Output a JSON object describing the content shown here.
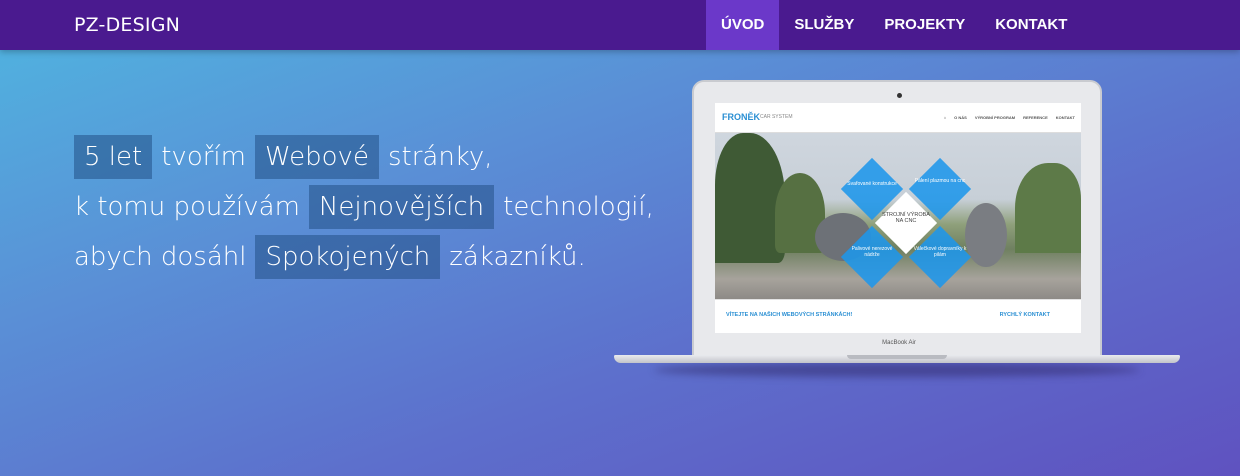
{
  "header": {
    "brand": "PZ-DESIGN",
    "nav": [
      {
        "label": "ÚVOD",
        "active": true
      },
      {
        "label": "SLUŽBY",
        "active": false
      },
      {
        "label": "PROJEKTY",
        "active": false
      },
      {
        "label": "KONTAKT",
        "active": false
      }
    ]
  },
  "hero": {
    "line1": {
      "hl1": "5 let",
      "text1": "tvořím",
      "hl2": "Webové",
      "text2": "stránky,"
    },
    "line2": {
      "text1": "k tomu používám",
      "hl1": "Nejnovějších",
      "text2": "technologií,"
    },
    "line3": {
      "text1": "abych dosáhl",
      "hl1": "Spokojených",
      "text2": "zákazníků."
    }
  },
  "laptop": {
    "model": "MacBook Air",
    "screen": {
      "logo": "FRONĚK",
      "logo_sub": "CAR SYSTEM",
      "menu": [
        "O NÁS",
        "VÝROBNÍ PROGRAM",
        "REFERENCE",
        "KONTAKT"
      ],
      "tiles": {
        "top_left": "Svařované konstrukce",
        "top_right": "Pálení plazmou na cnc",
        "center": "STROJNÍ VÝROBA NA CNC",
        "bottom_left": "Palivové nerezové nádrže",
        "bottom_right": "Válečkové dopravníky k pilám"
      },
      "footer_left": "VÍTEJTE NA NAŠICH WEBOVÝCH STRÁNKÁCH!",
      "footer_right": "RYCHLÝ KONTAKT"
    }
  },
  "colors": {
    "navbar": "#4a1a8f",
    "nav_active": "#6b38c9",
    "highlight": "#2a5a8c",
    "tile_blue": "#1e96eb"
  }
}
